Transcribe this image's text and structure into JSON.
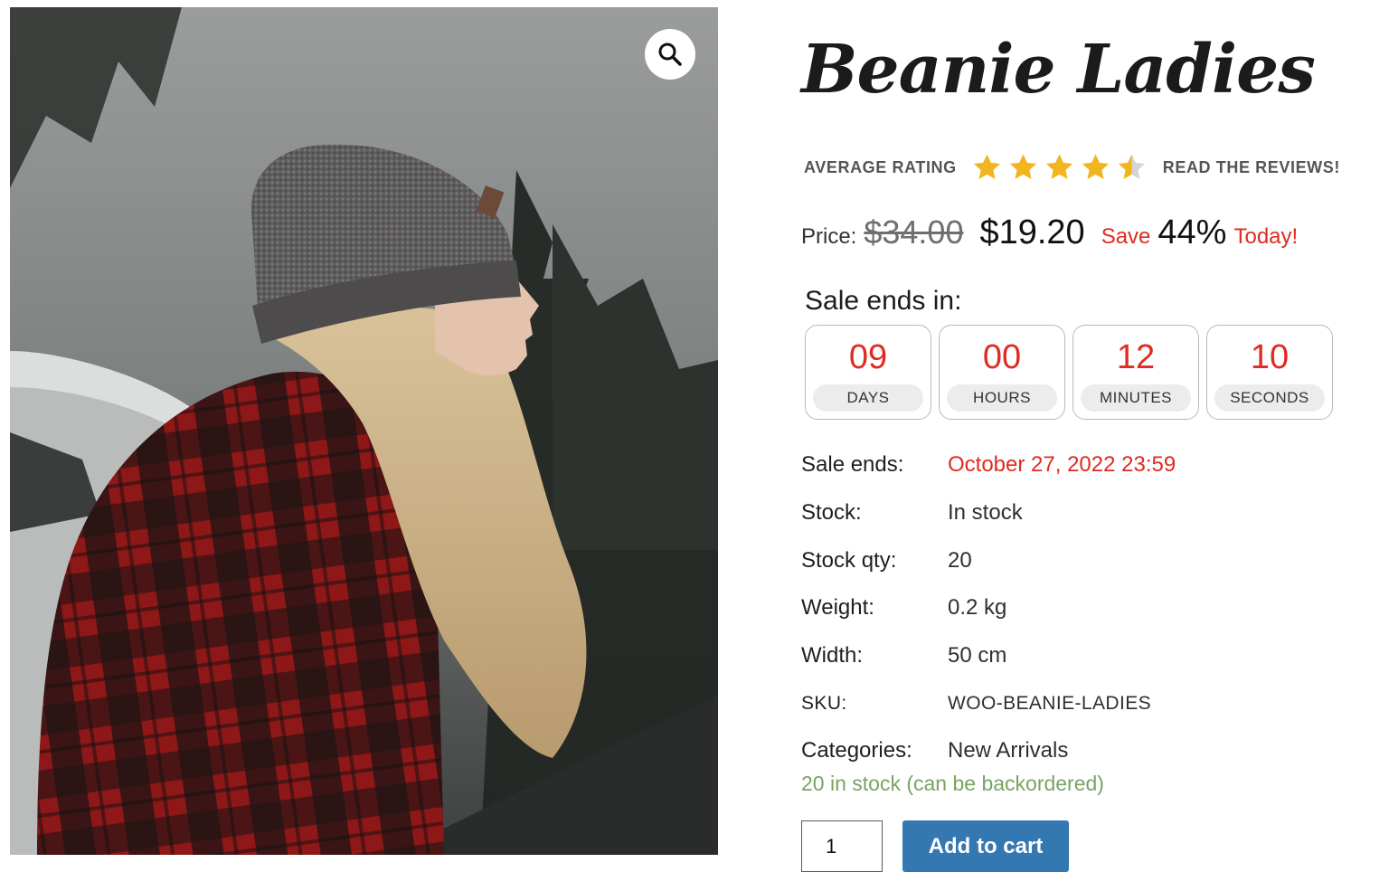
{
  "product": {
    "title": "Beanie Ladies",
    "image_alt": "Woman in grey beanie and red plaid shirt",
    "zoom_icon": "magnifier-icon"
  },
  "rating": {
    "label": "AVERAGE RATING",
    "value": 4.5,
    "max": 5,
    "star_color": "#f2b51f",
    "link": "READ THE REVIEWS!"
  },
  "price": {
    "label": "Price:",
    "regular": "$34.00",
    "sale": "$19.20",
    "save_prefix": "Save",
    "save_percent": "44%",
    "save_suffix": "Today!"
  },
  "countdown": {
    "heading": "Sale ends in:",
    "units": [
      {
        "value": "09",
        "label": "DAYS"
      },
      {
        "value": "00",
        "label": "HOURS"
      },
      {
        "value": "12",
        "label": "MINUTES"
      },
      {
        "value": "10",
        "label": "SECONDS"
      }
    ]
  },
  "meta": [
    {
      "label": "Sale ends:",
      "value": "October 27, 2022 23:59"
    },
    {
      "label": "Stock:",
      "value": "In stock"
    },
    {
      "label": "Stock qty:",
      "value": "20"
    },
    {
      "label": "Weight:",
      "value": "0.2 kg"
    },
    {
      "label": "Width:",
      "value": "50 cm"
    },
    {
      "label": "SKU:",
      "value": "WOO-BEANIE-LADIES"
    },
    {
      "label": "Categories:",
      "value": "New Arrivals"
    }
  ],
  "stock_message": "20 in stock (can be backordered)",
  "cart": {
    "quantity": "1",
    "button": "Add to cart"
  },
  "colors": {
    "accent_red": "#e02b20",
    "button_blue": "#3478b1",
    "stock_green": "#77a464"
  }
}
